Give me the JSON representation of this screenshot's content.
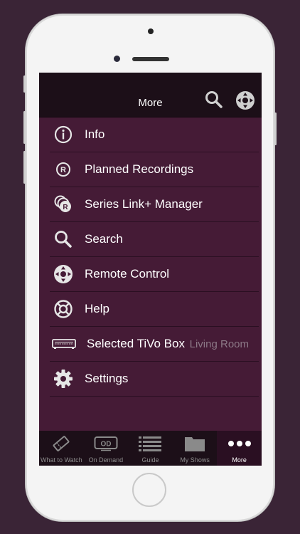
{
  "header": {
    "title": "More"
  },
  "menu": [
    {
      "label": "Info",
      "icon": "info-icon"
    },
    {
      "label": "Planned Recordings",
      "icon": "record-icon"
    },
    {
      "label": "Series Link+ Manager",
      "icon": "series-link-icon"
    },
    {
      "label": "Search",
      "icon": "search-icon"
    },
    {
      "label": "Remote Control",
      "icon": "remote-control-icon"
    },
    {
      "label": "Help",
      "icon": "help-lifebuoy-icon"
    },
    {
      "label": "Selected TiVo Box",
      "value": "Living Room",
      "icon": "tivo-box-icon"
    },
    {
      "label": "Settings",
      "icon": "gear-icon"
    }
  ],
  "tabs": [
    {
      "label": "What to Watch",
      "icon": "ticket-icon"
    },
    {
      "label": "On Demand",
      "icon": "on-demand-icon"
    },
    {
      "label": "Guide",
      "icon": "guide-list-icon"
    },
    {
      "label": "My Shows",
      "icon": "folder-icon"
    },
    {
      "label": "More",
      "icon": "more-dots-icon",
      "active": true
    }
  ],
  "colors": {
    "background": "#3a2436",
    "screen": "#451b36",
    "bar": "#1c0f18",
    "active_tab": "#2a0f22"
  }
}
